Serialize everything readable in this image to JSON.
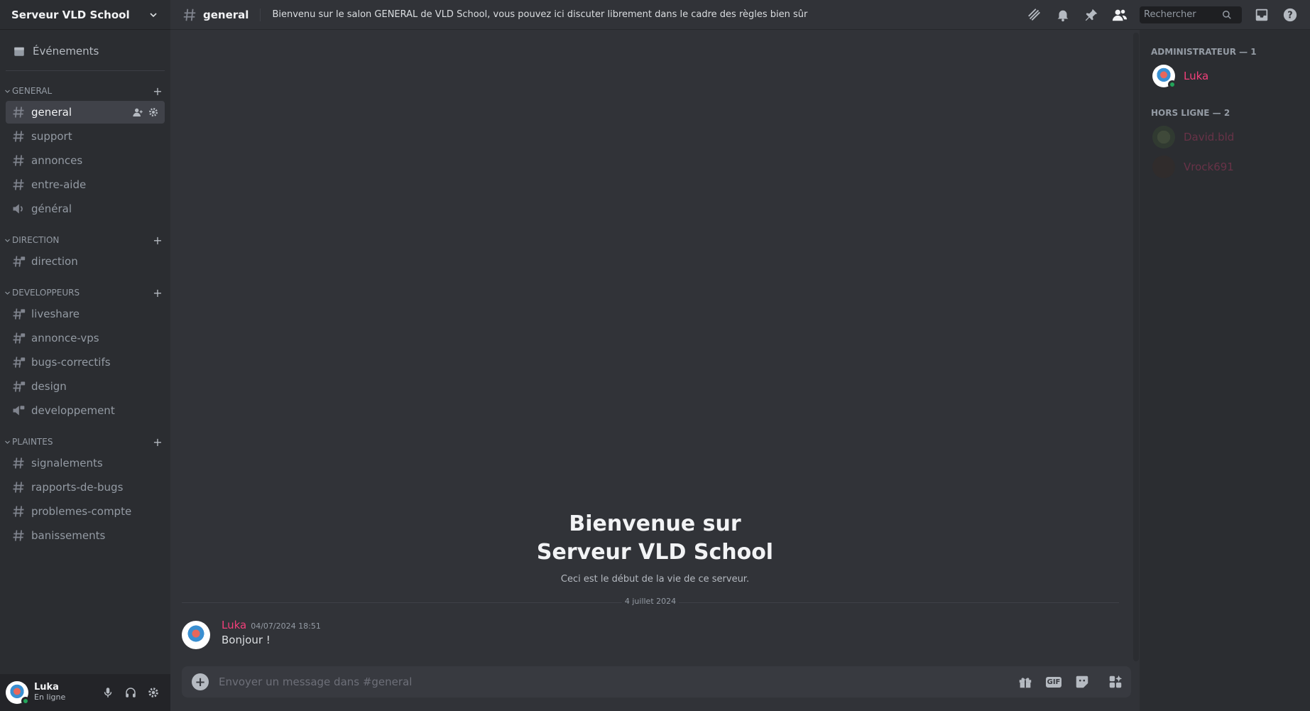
{
  "server": {
    "name": "Serveur VLD School"
  },
  "sidebar": {
    "events_label": "Événements",
    "categories": [
      {
        "name": "GENERAL",
        "channels": [
          {
            "label": "general",
            "type": "text",
            "active": true
          },
          {
            "label": "support",
            "type": "text"
          },
          {
            "label": "annonces",
            "type": "text"
          },
          {
            "label": "entre-aide",
            "type": "text"
          },
          {
            "label": "général",
            "type": "voice"
          }
        ]
      },
      {
        "name": "DIRECTION",
        "channels": [
          {
            "label": "direction",
            "type": "text-locked"
          }
        ]
      },
      {
        "name": "DEVELOPPEURS",
        "channels": [
          {
            "label": "liveshare",
            "type": "text-locked"
          },
          {
            "label": "annonce-vps",
            "type": "text-locked"
          },
          {
            "label": "bugs-correctifs",
            "type": "text-locked"
          },
          {
            "label": "design",
            "type": "text-locked"
          },
          {
            "label": "developpement",
            "type": "voice-locked"
          }
        ]
      },
      {
        "name": "PLAINTES",
        "channels": [
          {
            "label": "signalements",
            "type": "text"
          },
          {
            "label": "rapports-de-bugs",
            "type": "text"
          },
          {
            "label": "problemes-compte",
            "type": "text"
          },
          {
            "label": "banissements",
            "type": "text"
          }
        ]
      }
    ]
  },
  "user_panel": {
    "name": "Luka",
    "status": "En ligne"
  },
  "topbar": {
    "channel": "general",
    "topic": "Bienvenu sur le salon GENERAL de VLD School, vous pouvez ici discuter librement dans le cadre des règles bien sûr",
    "search_placeholder": "Rechercher"
  },
  "chat": {
    "welcome_line1": "Bienvenue sur",
    "welcome_line2": "Serveur VLD School",
    "welcome_sub": "Ceci est le début de la vie de ce serveur.",
    "divider_date": "4 juillet 2024",
    "message": {
      "author": "Luka",
      "time": "04/07/2024 18:51",
      "text": "Bonjour !"
    },
    "composer_placeholder": "Envoyer un message dans #general",
    "gif_label": "GIF"
  },
  "members": {
    "groups": [
      {
        "title": "ADMINISTRATEUR — 1",
        "members": [
          {
            "name": "Luka",
            "online": true,
            "avatar": "luka"
          }
        ]
      },
      {
        "title": "HORS LIGNE — 2",
        "members": [
          {
            "name": "David.bld",
            "online": false,
            "avatar": "david"
          },
          {
            "name": "Vrock691",
            "online": false,
            "avatar": "vrock"
          }
        ]
      }
    ]
  },
  "colors": {
    "accent_role": "#f23f7a",
    "online": "#23a55a",
    "sidebar_bg": "#2b2d31",
    "chat_bg": "#313338"
  }
}
